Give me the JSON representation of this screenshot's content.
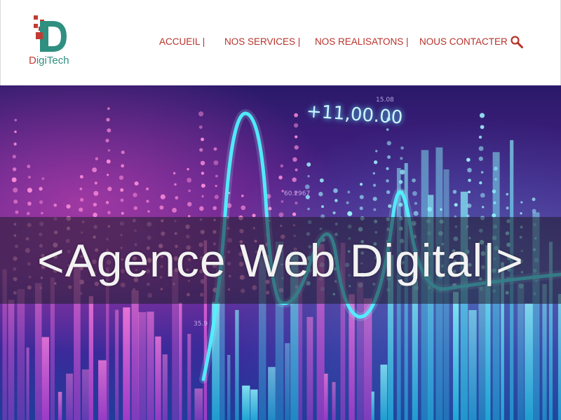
{
  "header": {
    "logo": {
      "brand_text": "DigiTech",
      "brand_first": "D",
      "brand_rest": "igiTech",
      "icon": "digitech-logo-icon"
    },
    "nav": [
      {
        "label": "ACCUEIL |"
      },
      {
        "label": "NOS SERVICES |"
      },
      {
        "label": "NOS REALISATONS |"
      },
      {
        "label": "NOUS CONTACTER"
      }
    ],
    "search_icon": "search-icon"
  },
  "hero": {
    "headline": "<Agence Web Digital|>",
    "ticker": "+11,00.00",
    "mini_labels": [
      "60.2967",
      "35.9",
      "15.08"
    ]
  },
  "colors": {
    "nav_text": "#b8322a",
    "logo_red": "#c23b33",
    "logo_teal": "#2f8f80",
    "hero_cyan": "#29e3f0",
    "hero_magenta": "#e85cc8"
  }
}
